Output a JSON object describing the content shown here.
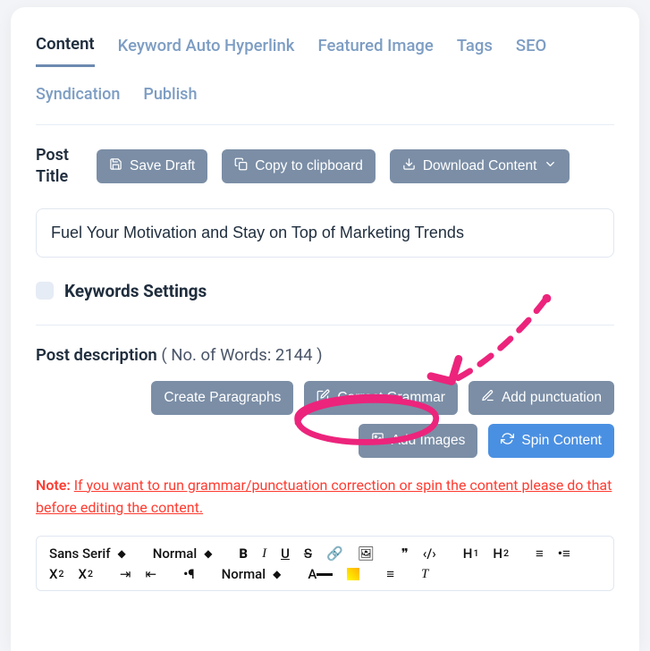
{
  "tabs_row1": [
    {
      "label": "Content",
      "active": true
    },
    {
      "label": "Keyword Auto Hyperlink"
    },
    {
      "label": "Featured Image"
    },
    {
      "label": "Tags"
    },
    {
      "label": "SEO"
    }
  ],
  "tabs_row2": [
    {
      "label": "Syndication"
    },
    {
      "label": "Publish"
    }
  ],
  "post_title": {
    "label": "Post Title",
    "value": "Fuel Your Motivation and Stay on Top of Marketing Trends"
  },
  "title_buttons": {
    "save_draft": "Save Draft",
    "copy_clipboard": "Copy to clipboard",
    "download_content": "Download Content"
  },
  "keywords": {
    "label": "Keywords Settings",
    "checked": false
  },
  "description": {
    "label": "Post description",
    "meta_prefix": "( No. of Words: ",
    "word_count": "2144",
    "meta_suffix": " )"
  },
  "desc_buttons": {
    "create_paragraphs": "Create Paragraphs",
    "correct_grammar": "Correct Grammar",
    "add_punctuation": "Add punctuation",
    "add_images": "Add Images",
    "spin_content": "Spin Content"
  },
  "note": {
    "prefix": "Note:",
    "text": "If you want to run grammar/punctuation correction or spin the content please do that before editing the content."
  },
  "editor_toolbar": {
    "font": "Sans Serif",
    "size": "Normal",
    "B": "B",
    "I": "I",
    "U": "U",
    "S": "S",
    "H": "H",
    "X": "X",
    "A": "A",
    "T": "T",
    "quote": "❞",
    "code": "‹/›",
    "link": "🔗",
    "image": "🖼",
    "ol": "≡",
    "ul": "•≡",
    "indent_r": "⇥",
    "indent_l": "⇤",
    "pilcrow": "•¶",
    "size2": "Normal",
    "clear": "Ⓧ"
  }
}
